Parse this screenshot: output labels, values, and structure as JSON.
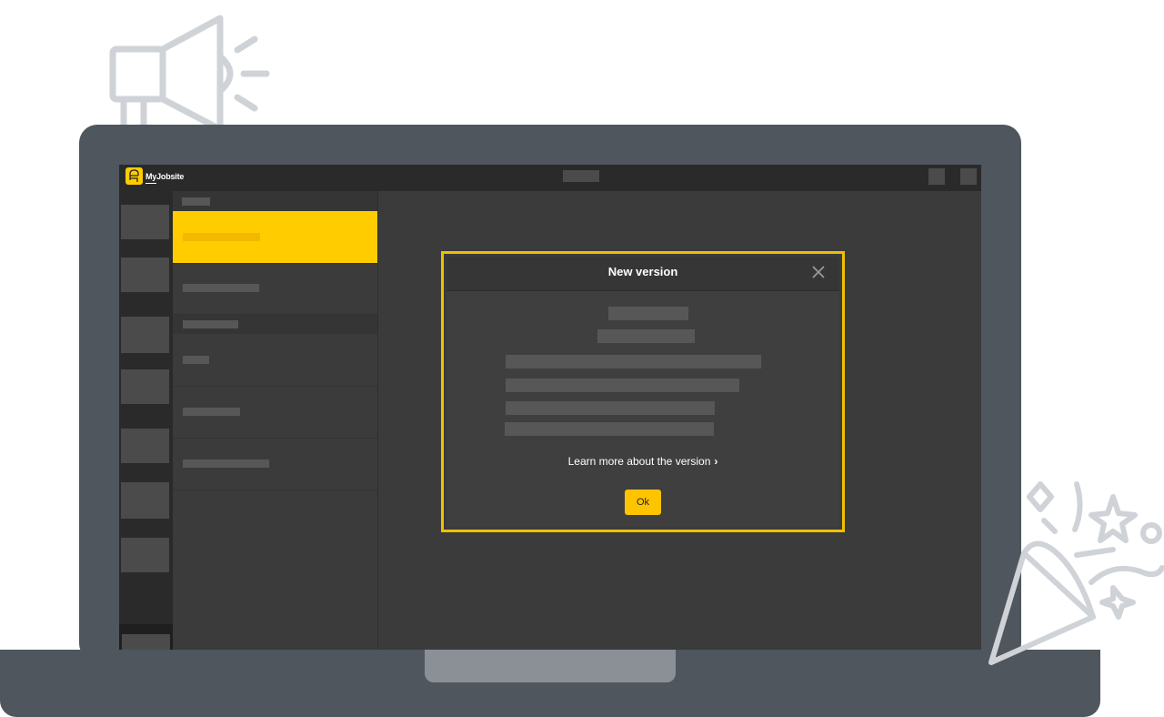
{
  "app": {
    "name": "MyJobsite",
    "brand_color": "#ffcc00"
  },
  "modal": {
    "title": "New version",
    "learn_more_label": "Learn more about the version",
    "learn_more_chevron": "›",
    "ok_label": "Ok",
    "outline_color": "#f0c000"
  },
  "icons": {
    "megaphone": "megaphone-icon",
    "party_popper": "party-popper-icon",
    "close": "close-icon",
    "logo": "logo-icon"
  }
}
